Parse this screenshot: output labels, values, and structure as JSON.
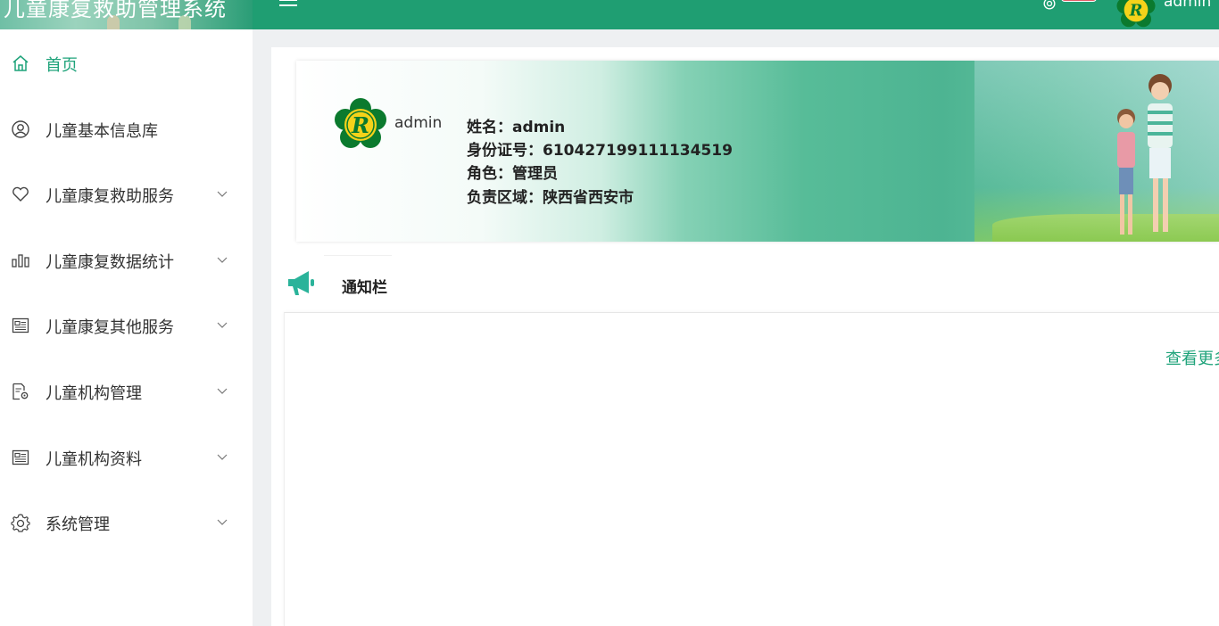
{
  "app": {
    "title": "儿童康复救助管理系统",
    "username": "admin"
  },
  "sidebar": {
    "items": [
      {
        "label": "首页",
        "icon": "home-icon",
        "active": true,
        "has_submenu": false
      },
      {
        "label": "儿童基本信息库",
        "icon": "user-circle-icon",
        "active": false,
        "has_submenu": false
      },
      {
        "label": "儿童康复救助服务",
        "icon": "heart-icon",
        "active": false,
        "has_submenu": true
      },
      {
        "label": "儿童康复数据统计",
        "icon": "bar-chart-icon",
        "active": false,
        "has_submenu": true
      },
      {
        "label": "儿童康复其他服务",
        "icon": "document-icon",
        "active": false,
        "has_submenu": true
      },
      {
        "label": "儿童机构管理",
        "icon": "doc-gear-icon",
        "active": false,
        "has_submenu": true
      },
      {
        "label": "儿童机构资料",
        "icon": "document-icon",
        "active": false,
        "has_submenu": true
      },
      {
        "label": "系统管理",
        "icon": "gear-icon",
        "active": false,
        "has_submenu": true
      }
    ]
  },
  "profile": {
    "username": "admin",
    "name_line": "姓名：admin",
    "id_line": "身份证号：610427199111134519",
    "role_line": "角色：管理员",
    "region_line": "负责区域：陕西省西安市"
  },
  "notice": {
    "tab_label": "通知栏",
    "more_label": "查看更多"
  },
  "colors": {
    "topbar": "#1f9e72",
    "accent": "#1ea37a",
    "logo_green": "#0b7a2e",
    "logo_yellow": "#f5d21a"
  }
}
